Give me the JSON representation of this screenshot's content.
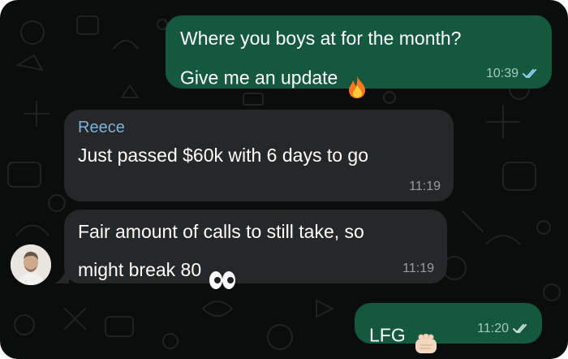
{
  "messages": [
    {
      "direction": "outgoing",
      "text": "Where you boys at for the month?\nGive me an update",
      "emoji": "fire-emoji",
      "time": "10:39",
      "status": "read"
    },
    {
      "direction": "incoming",
      "sender": "Reece",
      "text": "Just passed $60k with 6 days to go",
      "time": "11:19"
    },
    {
      "direction": "incoming",
      "text": "Fair amount of calls to still take, so\nmight break 80",
      "emoji": "eyes-emoji",
      "time": "11:19"
    },
    {
      "direction": "outgoing",
      "text": "LFG",
      "emoji": "fist-bump-emoji",
      "time": "11:20",
      "status": "delivered"
    }
  ],
  "colors": {
    "background": "#0b0d0c",
    "outgoing_bubble": "#14583f",
    "incoming_bubble": "#262728",
    "sender_name": "#7fb2d8",
    "read_ticks": "#8fd1f2",
    "delivered_ticks": "#cfe3d8"
  }
}
